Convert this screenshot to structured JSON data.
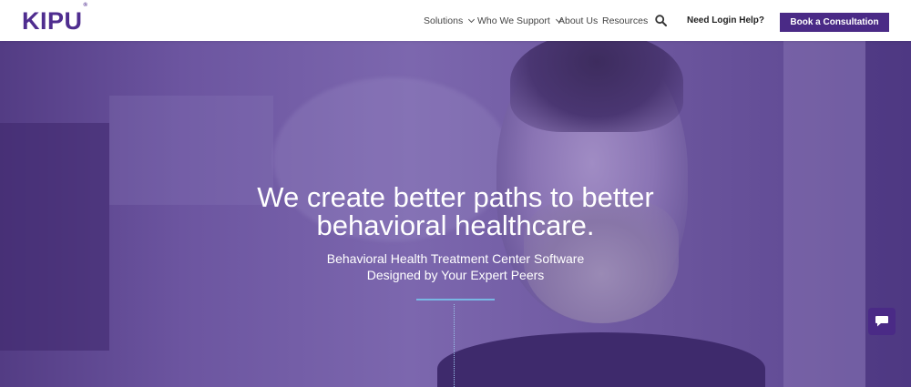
{
  "header": {
    "logo": {
      "text": "KIPU",
      "mark": "®"
    },
    "nav": [
      {
        "label": "Solutions",
        "has_dropdown": true
      },
      {
        "label": "Who We Support",
        "has_dropdown": true
      },
      {
        "label": "About Us",
        "has_dropdown": false
      },
      {
        "label": "Resources",
        "has_dropdown": false
      }
    ],
    "search_icon": "search-icon",
    "login_help": "Need Login Help?",
    "cta": "Book a Consultation"
  },
  "hero": {
    "headline_line1": "We create better paths to better",
    "headline_line2": "behavioral healthcare.",
    "subhead_line1": "Behavioral Health Treatment Center Software",
    "subhead_line2": "Designed by Your Expert Peers"
  },
  "chat_widget": {
    "icon": "chat-bubble-icon"
  },
  "colors": {
    "brand_purple": "#4a2a86",
    "logo_purple": "#4f2d8f",
    "hero_overlay": "#6c55a0",
    "accent_blue": "#78b7e4"
  }
}
